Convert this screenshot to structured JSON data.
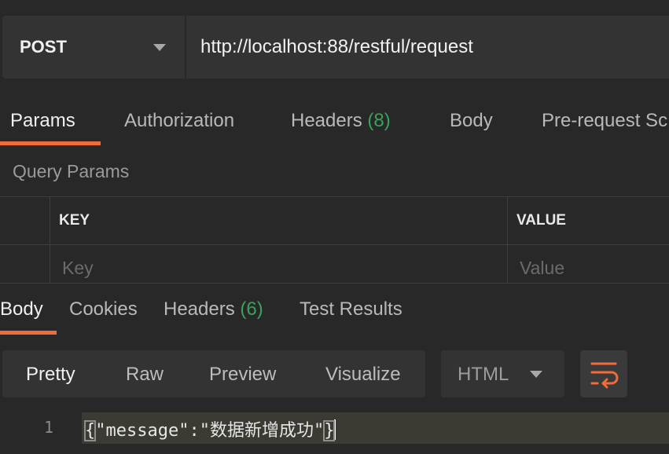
{
  "request": {
    "method": "POST",
    "url": "http://localhost:88/restful/request"
  },
  "request_tabs": {
    "params": "Params",
    "authorization": "Authorization",
    "headers": "Headers",
    "headers_count": "(8)",
    "body": "Body",
    "prerequest": "Pre-request Sc"
  },
  "query_params": {
    "title": "Query Params",
    "columns": {
      "key": "KEY",
      "value": "VALUE"
    },
    "placeholder_row": {
      "key": "Key",
      "value": "Value"
    }
  },
  "response_tabs": {
    "body": "Body",
    "cookies": "Cookies",
    "headers": "Headers",
    "headers_count": "(6)",
    "test_results": "Test Results"
  },
  "view_modes": {
    "pretty": "Pretty",
    "raw": "Raw",
    "preview": "Preview",
    "visualize": "Visualize",
    "format": "HTML"
  },
  "response_body": {
    "line_number": "1",
    "open_brace": "{",
    "content": "\"message\":\"数据新增成功\"",
    "close_brace": "}"
  },
  "colors": {
    "accent": "#f26b3a",
    "count": "#3aa15c",
    "background": "#282828"
  },
  "icons": {
    "method_dropdown": "chevron-down-icon",
    "format_dropdown": "chevron-down-icon",
    "wrap": "wrap-lines-icon"
  }
}
